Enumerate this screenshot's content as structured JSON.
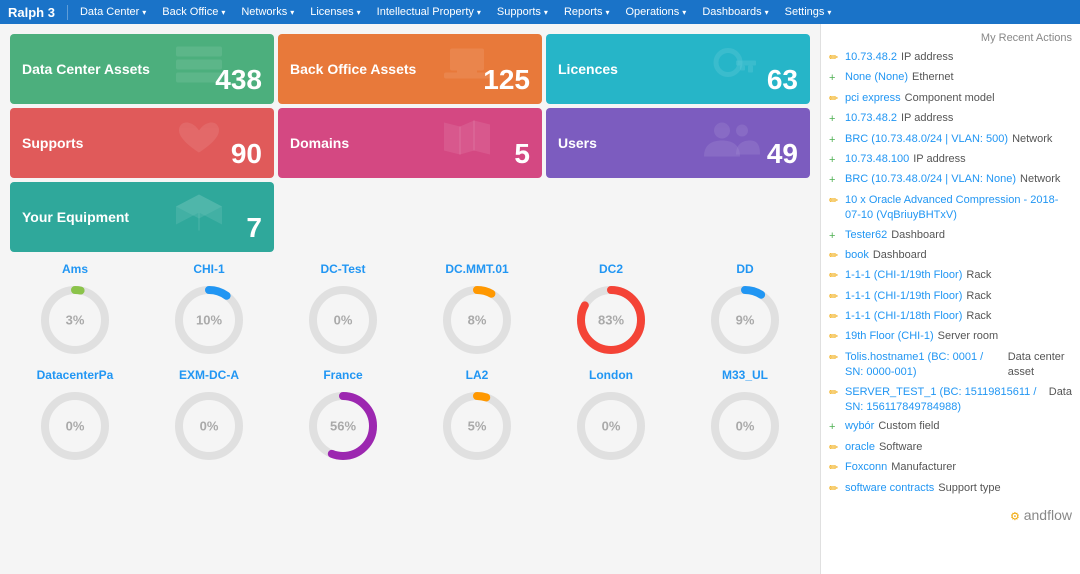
{
  "navbar": {
    "brand": "Ralph 3",
    "items": [
      {
        "label": "Data Center",
        "has_arrow": true
      },
      {
        "label": "Back Office",
        "has_arrow": true
      },
      {
        "label": "Networks",
        "has_arrow": true
      },
      {
        "label": "Licenses",
        "has_arrow": true
      },
      {
        "label": "Intellectual Property",
        "has_arrow": true
      },
      {
        "label": "Supports",
        "has_arrow": true
      },
      {
        "label": "Reports",
        "has_arrow": true
      },
      {
        "label": "Operations",
        "has_arrow": true
      },
      {
        "label": "Dashboards",
        "has_arrow": true
      },
      {
        "label": "Settings",
        "has_arrow": true
      }
    ]
  },
  "cards": [
    {
      "id": "data-center-assets",
      "title": "Data Center Assets",
      "count": "438",
      "color": "card-green",
      "icon": "≡"
    },
    {
      "id": "back-office-assets",
      "title": "Back Office Assets",
      "count": "125",
      "color": "card-orange",
      "icon": "💻"
    },
    {
      "id": "licences",
      "title": "Licences",
      "count": "63",
      "color": "card-cyan",
      "icon": "🔑"
    },
    {
      "id": "supports",
      "title": "Supports",
      "count": "90",
      "color": "card-red",
      "icon": "♥"
    },
    {
      "id": "domains",
      "title": "Domains",
      "count": "5",
      "color": "card-pink",
      "icon": "🗺"
    },
    {
      "id": "users",
      "title": "Users",
      "count": "49",
      "color": "card-purple",
      "icon": "👥"
    },
    {
      "id": "your-equipment",
      "title": "Your Equipment",
      "count": "7",
      "color": "card-teal",
      "icon": "⬡"
    }
  ],
  "charts_row1": [
    {
      "label": "Ams",
      "pct": 3,
      "color": "#8BC34A"
    },
    {
      "label": "CHI-1",
      "pct": 10,
      "color": "#2196F3"
    },
    {
      "label": "DC-Test",
      "pct": 0,
      "color": "#9E9E9E"
    },
    {
      "label": "DC.MMT.01",
      "pct": 8,
      "color": "#FF9800"
    },
    {
      "label": "DC2",
      "pct": 83,
      "color": "#f44336"
    },
    {
      "label": "DD",
      "pct": 9,
      "color": "#2196F3"
    }
  ],
  "charts_row2": [
    {
      "label": "DatacenterPa",
      "pct": 0,
      "color": "#9E9E9E"
    },
    {
      "label": "EXM-DC-A",
      "pct": 0,
      "color": "#9E9E9E"
    },
    {
      "label": "France",
      "pct": 56,
      "color": "#9C27B0"
    },
    {
      "label": "LA2",
      "pct": 5,
      "color": "#FF9800"
    },
    {
      "label": "London",
      "pct": 0,
      "color": "#9E9E9E"
    },
    {
      "label": "M33_UL",
      "pct": 0,
      "color": "#9E9E9E"
    }
  ],
  "sidebar": {
    "title": "My Recent Actions",
    "items": [
      {
        "icon": "✏",
        "icon_class": "icon-yellow",
        "link": "10.73.48.2",
        "text": " IP address"
      },
      {
        "icon": "+",
        "icon_class": "icon-green",
        "link": "None (None)",
        "text": " Ethernet"
      },
      {
        "icon": "✏",
        "icon_class": "icon-yellow",
        "link": "pci express",
        "text": " Component model"
      },
      {
        "icon": "+",
        "icon_class": "icon-green",
        "link": "10.73.48.2",
        "text": " IP address"
      },
      {
        "icon": "+",
        "icon_class": "icon-green",
        "link": "BRC (10.73.48.0/24 | VLAN: 500)",
        "text": " Network"
      },
      {
        "icon": "+",
        "icon_class": "icon-green",
        "link": "10.73.48.100",
        "text": " IP address"
      },
      {
        "icon": "+",
        "icon_class": "icon-green",
        "link": "BRC (10.73.48.0/24 | VLAN: None)",
        "text": " Network"
      },
      {
        "icon": "✏",
        "icon_class": "icon-yellow",
        "link": "10 x Oracle Advanced Compression - 2018-07-10 (VqBriuyBHTxV)",
        "text": ""
      },
      {
        "icon": "+",
        "icon_class": "icon-green",
        "link": "Tester62",
        "text": " Dashboard"
      },
      {
        "icon": "✏",
        "icon_class": "icon-yellow",
        "link": "book",
        "text": " Dashboard"
      },
      {
        "icon": "✏",
        "icon_class": "icon-yellow",
        "link": "1-1-1 (CHI-1/19th Floor)",
        "text": " Rack"
      },
      {
        "icon": "✏",
        "icon_class": "icon-yellow",
        "link": "1-1-1 (CHI-1/19th Floor)",
        "text": " Rack"
      },
      {
        "icon": "✏",
        "icon_class": "icon-yellow",
        "link": "1-1-1 (CHI-1/18th Floor)",
        "text": " Rack"
      },
      {
        "icon": "✏",
        "icon_class": "icon-yellow",
        "link": "19th Floor (CHI-1)",
        "text": " Server room"
      },
      {
        "icon": "✏",
        "icon_class": "icon-yellow",
        "link": "Tolis.hostname1 (BC: 0001 / SN: 0000-001)",
        "text": " Data center asset"
      },
      {
        "icon": "✏",
        "icon_class": "icon-yellow",
        "link": "SERVER_TEST_1 (BC: 15119815611 / SN: 156117849784988)",
        "text": " Data"
      },
      {
        "icon": "+",
        "icon_class": "icon-green",
        "link": "wybór",
        "text": " Custom field"
      },
      {
        "icon": "✏",
        "icon_class": "icon-yellow",
        "link": "oracle",
        "text": " Software"
      },
      {
        "icon": "✏",
        "icon_class": "icon-yellow",
        "link": "Foxconn",
        "text": " Manufacturer"
      },
      {
        "icon": "✏",
        "icon_class": "icon-yellow",
        "link": "software contracts",
        "text": " Support type"
      }
    ]
  }
}
